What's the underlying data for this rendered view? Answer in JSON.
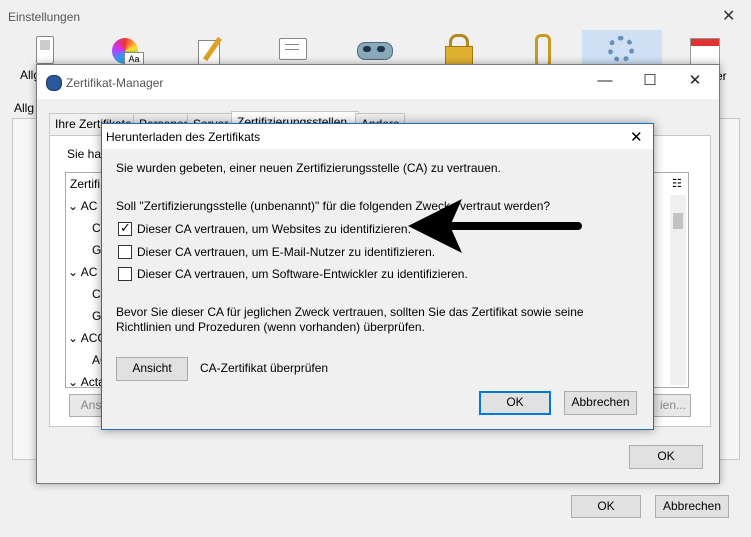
{
  "einstellungen": {
    "title": "Einstellungen",
    "close_icon": "close-icon",
    "toolbar": [
      {
        "label": "Allgemein",
        "visible_label": "Allg",
        "icon": "switch-icon"
      },
      {
        "label": "",
        "icon": "font-color-icon"
      },
      {
        "label": "",
        "icon": "compose-icon"
      },
      {
        "label": "",
        "icon": "chat-icon"
      },
      {
        "label": "",
        "icon": "mask-icon"
      },
      {
        "label": "",
        "icon": "lock-icon"
      },
      {
        "label": "",
        "icon": "paperclip-icon"
      },
      {
        "label": "",
        "icon": "gear-icon",
        "selected": true
      },
      {
        "label": "",
        "visible_label": "er",
        "icon": "calendar-icon"
      }
    ],
    "section_label": "Allg",
    "ok": "OK",
    "abbrechen": "Abbrechen"
  },
  "cert_manager": {
    "title": "Zertifikat-Manager",
    "tabs": [
      "Ihre Zertifikate",
      "Personen",
      "Server",
      "Zertifizierungsstellen",
      "Andere"
    ],
    "active_tab": 3,
    "intro": "Sie hal",
    "column_header": "Zertifi",
    "tree": [
      "AC C",
      "Cl",
      "GI",
      "AC C",
      "Cl",
      "GI",
      "ACC",
      "AC",
      "Acta"
    ],
    "left_partial_button": "Ansc",
    "right_partial_button": "ien...",
    "ok": "OK"
  },
  "download_dialog": {
    "title": "Herunterladen des Zertifikats",
    "message1": "Sie wurden gebeten, einer neuen Zertifizierungsstelle (CA) zu vertrauen.",
    "message2": "Soll \"Zertifizierungsstelle (unbenannt)\" für die folgenden Zwecke vertraut werden?",
    "options": [
      {
        "label": "Dieser CA vertrauen, um Websites zu identifizieren.",
        "checked": true
      },
      {
        "label": "Dieser CA vertrauen, um E-Mail-Nutzer zu identifizieren.",
        "checked": false
      },
      {
        "label": "Dieser CA vertrauen, um Software-Entwickler zu identifizieren.",
        "checked": false
      }
    ],
    "message3": "Bevor Sie dieser CA für jeglichen Zweck vertrauen, sollten Sie das Zertifikat sowie seine Richtlinien und Prozeduren (wenn vorhanden) überprüfen.",
    "view_button": "Ansicht",
    "view_caption": "CA-Zertifikat überprüfen",
    "ok": "OK",
    "cancel": "Abbrechen"
  },
  "colors": {
    "selected_tool": "#cfe0f5",
    "focus": "#0078d7",
    "arrow": "#000000"
  }
}
